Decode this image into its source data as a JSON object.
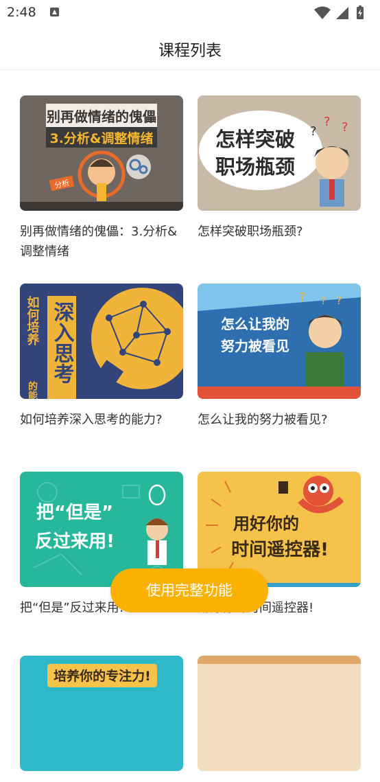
{
  "status_bar": {
    "time": "2:48"
  },
  "app_bar": {
    "title": "课程列表"
  },
  "courses": [
    {
      "title": "别再做情绪的傀儡：3.分析&调整情绪",
      "thumb_lines": [
        "别再做情绪的傀儡",
        "3.分析&调整情绪"
      ],
      "thumb_tag": "分析"
    },
    {
      "title": "怎样突破职场瓶颈?",
      "thumb_lines": [
        "怎样突破",
        "职场瓶颈"
      ]
    },
    {
      "title": "如何培养深入思考的能力?",
      "thumb_lines": [
        "如何培养",
        "深入思考",
        "的能"
      ]
    },
    {
      "title": "怎么让我的努力被看见?",
      "thumb_lines": [
        "怎么让我的",
        "努力被看见"
      ]
    },
    {
      "title": "把“但是”反过来用!",
      "thumb_lines": [
        "把“但是”",
        "反过来用!"
      ]
    },
    {
      "title": "用好你的时间遥控器!",
      "thumb_lines": [
        "用好你的",
        "时间遥控器!"
      ]
    },
    {
      "title": "",
      "thumb_lines": [
        "培养你的专注力!"
      ]
    },
    {
      "title": "",
      "thumb_lines": []
    }
  ],
  "fab": {
    "label": "使用完整功能"
  },
  "colors": {
    "accent": "#fbb100",
    "text": "#333333"
  }
}
